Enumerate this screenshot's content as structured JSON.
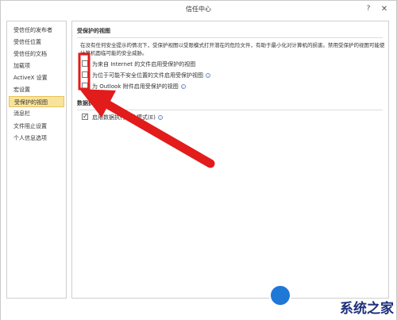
{
  "window": {
    "title": "信任中心",
    "help_glyph": "?",
    "close_glyph": "✕"
  },
  "sidebar": {
    "items": [
      {
        "label": "受信任的发布者",
        "active": false
      },
      {
        "label": "受信任位置",
        "active": false
      },
      {
        "label": "受信任的文档",
        "active": false
      },
      {
        "label": "加载项",
        "active": false
      },
      {
        "label": "ActiveX 设置",
        "active": false
      },
      {
        "label": "宏设置",
        "active": false
      },
      {
        "label": "受保护的视图",
        "active": true
      },
      {
        "label": "消息栏",
        "active": false
      },
      {
        "label": "文件阻止设置",
        "active": false
      },
      {
        "label": "个人信息选项",
        "active": false
      }
    ]
  },
  "protected_view": {
    "heading": "受保护的视图",
    "description": "在没有任何安全提示的情况下，受保护视图以受限模式打开潜在的危险文件，有助于最小化对计算机的损害。禁用受保护的视图可能使计算机面临可能的安全威胁。",
    "options": [
      {
        "label": "为来自 Internet 的文件启用受保护的视图",
        "checked": false,
        "info": false
      },
      {
        "label": "为位于可能不安全位置的文件启用受保护视图",
        "checked": false,
        "info": true
      },
      {
        "label": "为 Outlook 附件启用受保护的视图",
        "checked": false,
        "info": true
      }
    ]
  },
  "data_section": {
    "heading": "数据执",
    "option": {
      "label": "启用数据执行防护模式(E)",
      "checked": true,
      "info": true
    }
  },
  "watermark": {
    "text": "系统之家"
  },
  "colors": {
    "arrow": "#e21b1b",
    "active_bg": "#f8e39a",
    "watermark": "#1e2f7a"
  }
}
